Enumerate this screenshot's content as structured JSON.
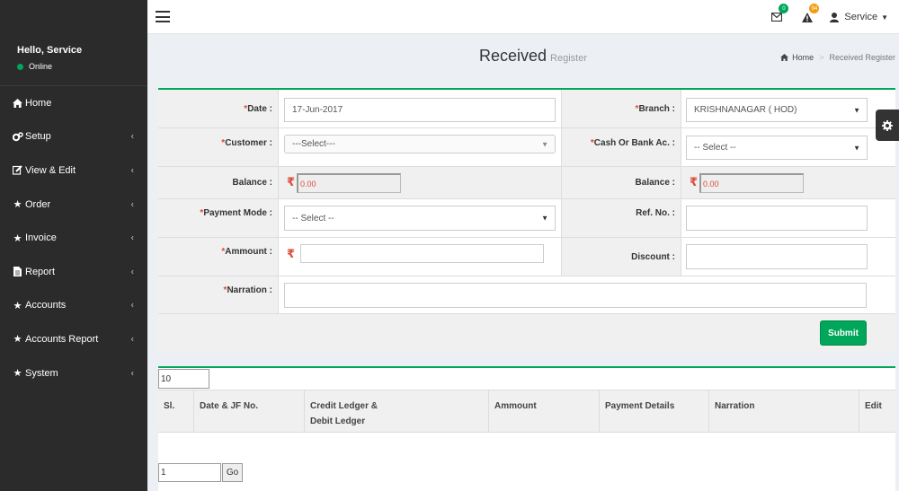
{
  "sidebar": {
    "greeting": "Hello, Service",
    "status": "Online",
    "items": [
      {
        "label": "Home"
      },
      {
        "label": "Setup"
      },
      {
        "label": "View & Edit"
      },
      {
        "label": "Order"
      },
      {
        "label": "Invoice"
      },
      {
        "label": "Report"
      },
      {
        "label": "Accounts"
      },
      {
        "label": "Accounts Report"
      },
      {
        "label": "System"
      }
    ]
  },
  "topbar": {
    "mail_count": "0",
    "alert_count": "94",
    "user_name": "Service"
  },
  "header": {
    "title": "Received",
    "subtitle": "Register",
    "breadcrumb_home": "Home",
    "breadcrumb_current": "Received Register"
  },
  "form": {
    "date_label": "Date :",
    "date_value": "17-Jun-2017",
    "branch_label": "Branch :",
    "branch_value": "KRISHNANAGAR ( HOD)",
    "customer_label": "Customer :",
    "customer_value": "---Select---",
    "cash_bank_label": "Cash Or Bank Ac. :",
    "cash_bank_value": "-- Select --",
    "balance_label": "Balance :",
    "balance_left_value": "0.00",
    "balance_right_label": "Balance :",
    "balance_right_value": "0.00",
    "payment_mode_label": "Payment Mode :",
    "payment_mode_value": "-- Select --",
    "ref_no_label": "Ref. No. :",
    "ref_no_value": "",
    "amount_label": "Ammount :",
    "amount_value": "",
    "discount_label": "Discount :",
    "discount_value": "",
    "narration_label": "Narration :",
    "narration_value": "",
    "required_mark": "*",
    "currency_symbol": "₹",
    "submit_label": "Submit"
  },
  "table": {
    "page_length": "10",
    "columns": [
      {
        "label": "Sl."
      },
      {
        "label": "Date & JF No."
      },
      {
        "label": "Credit Ledger &",
        "label2": "Debit Ledger"
      },
      {
        "label": "Ammount"
      },
      {
        "label": "Payment Details"
      },
      {
        "label": "Narration"
      },
      {
        "label": "Edit"
      }
    ],
    "page_number": "1",
    "go_label": "Go"
  },
  "colors": {
    "sidebar_bg": "#2b2b2b",
    "accent_green": "#00a65a",
    "required_red": "#dd4b39",
    "badge_orange": "#f39c12"
  }
}
